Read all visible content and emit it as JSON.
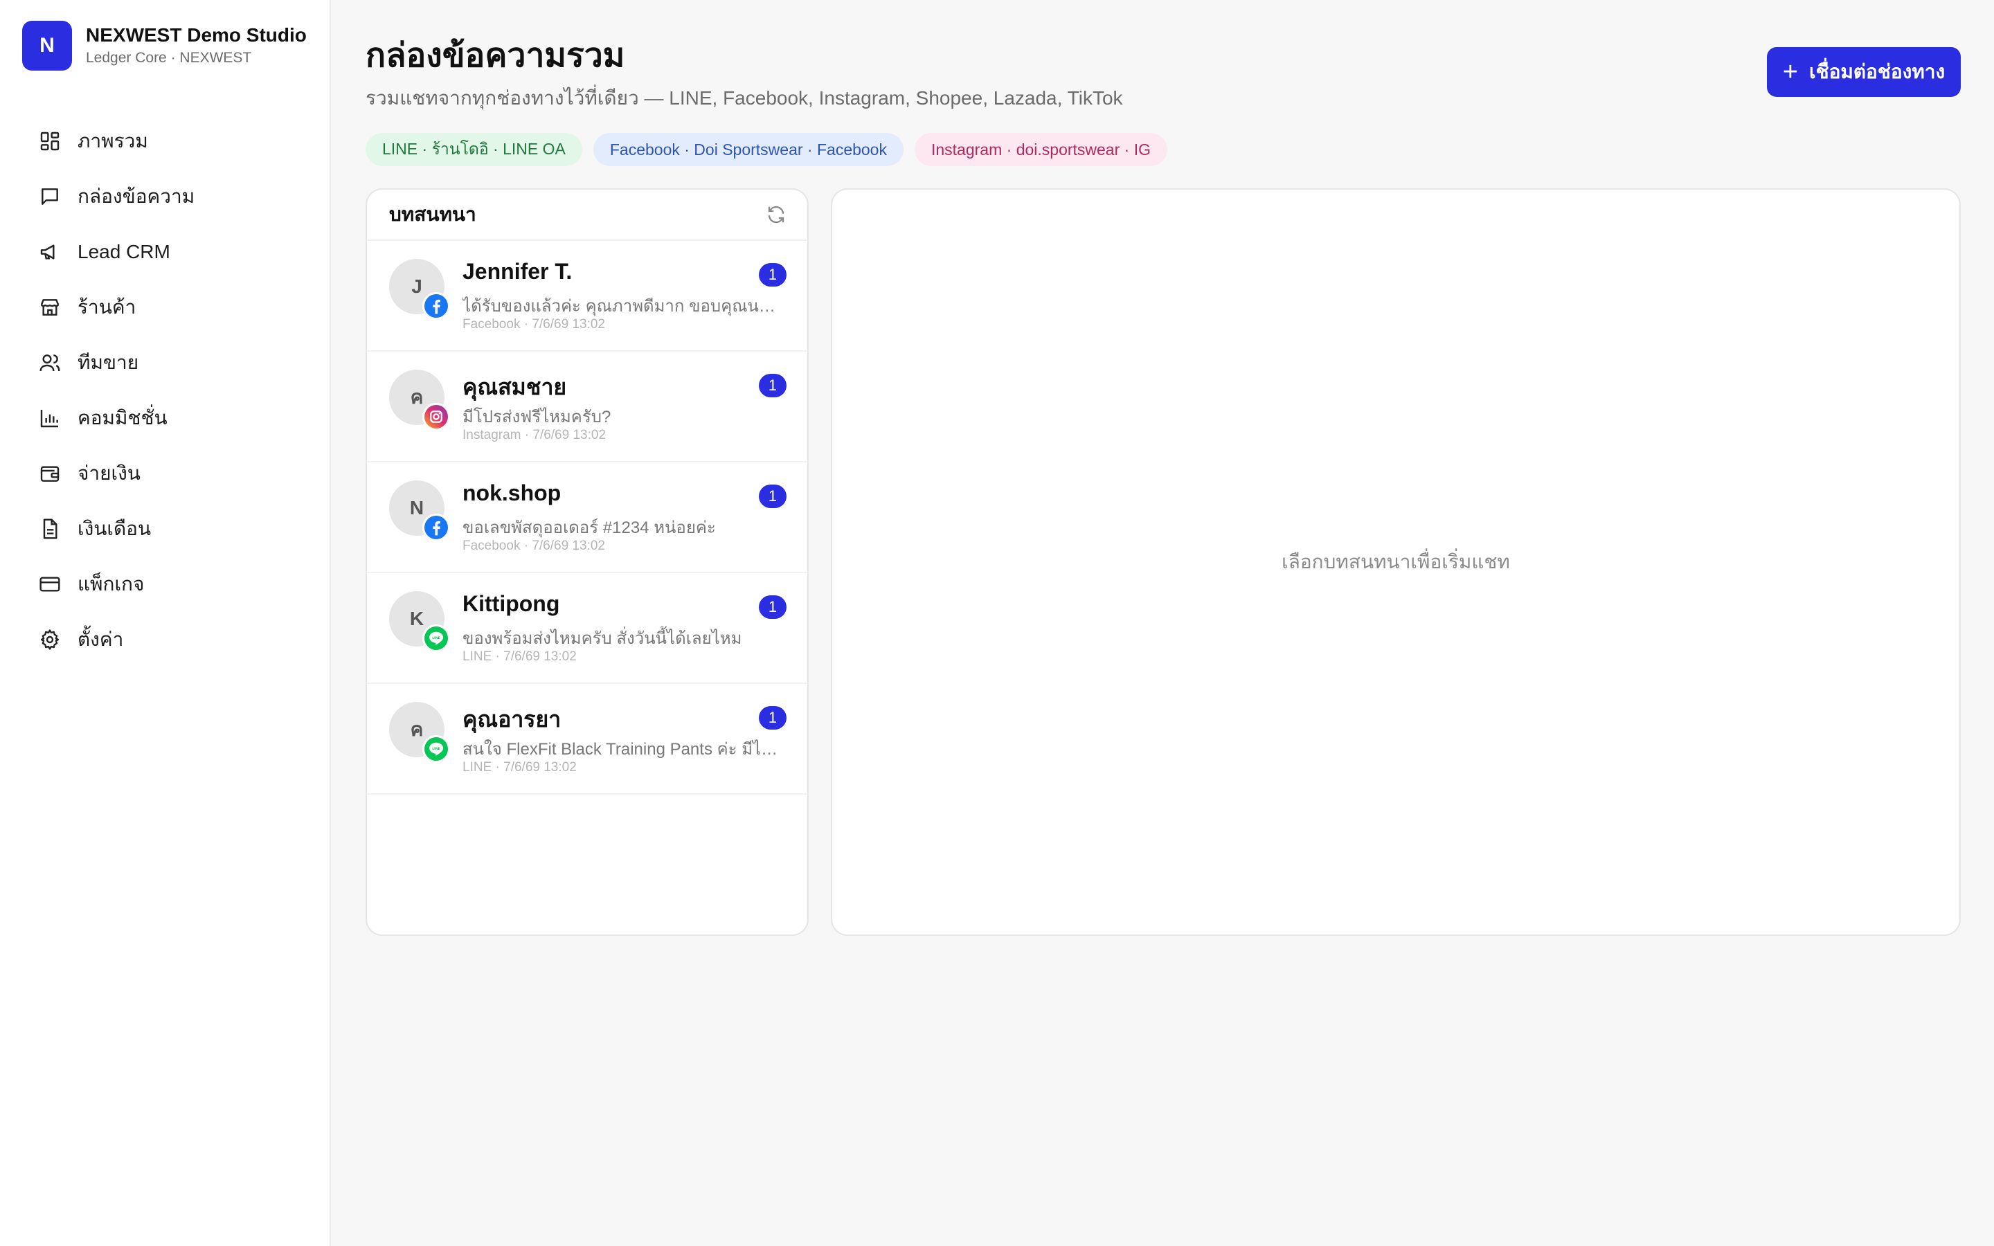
{
  "brand": {
    "logo_letter": "N",
    "name": "NEXWEST Demo Studio",
    "subtitle": "Ledger Core · NEXWEST",
    "accent": "#2a2ee0"
  },
  "nav": {
    "items": [
      {
        "label": "ภาพรวม",
        "icon": "dashboard-icon"
      },
      {
        "label": "กล่องข้อความ",
        "icon": "chat-icon"
      },
      {
        "label": "Lead CRM",
        "icon": "megaphone-icon"
      },
      {
        "label": "ร้านค้า",
        "icon": "store-icon"
      },
      {
        "label": "ทีมขาย",
        "icon": "users-icon"
      },
      {
        "label": "คอมมิชชั่น",
        "icon": "bar-chart-icon"
      },
      {
        "label": "จ่ายเงิน",
        "icon": "wallet-icon"
      },
      {
        "label": "เงินเดือน",
        "icon": "document-icon"
      },
      {
        "label": "แพ็กเกจ",
        "icon": "credit-card-icon"
      },
      {
        "label": "ตั้งค่า",
        "icon": "gear-icon"
      }
    ]
  },
  "header": {
    "title": "กล่องข้อความรวม",
    "subtitle": "รวมแชทจากทุกช่องทางไว้ที่เดียว — LINE, Facebook, Instagram, Shopee, Lazada, TikTok",
    "connect_button": "เชื่อมต่อช่องทาง"
  },
  "channels": [
    {
      "label": "LINE · ร้านโดอิ · LINE OA",
      "type": "line"
    },
    {
      "label": "Facebook · Doi Sportswear · Facebook",
      "type": "facebook"
    },
    {
      "label": "Instagram · doi.sportswear · IG",
      "type": "instagram"
    }
  ],
  "conversations": {
    "title": "บทสนทนา",
    "items": [
      {
        "initial": "J",
        "name": "Jennifer T.",
        "preview": "ได้รับของแล้วค่ะ คุณภาพดีมาก ขอบคุณนะคะ 😊",
        "meta": "Facebook · 7/6/69 13:02",
        "unread": "1",
        "channel": "facebook"
      },
      {
        "initial": "ค",
        "name": "คุณสมชาย",
        "preview": "มีโปรส่งฟรีไหมครับ?",
        "meta": "Instagram · 7/6/69 13:02",
        "unread": "1",
        "channel": "instagram"
      },
      {
        "initial": "N",
        "name": "nok.shop",
        "preview": "ขอเลขพัสดุออเดอร์ #1234 หน่อยค่ะ",
        "meta": "Facebook · 7/6/69 13:02",
        "unread": "1",
        "channel": "facebook"
      },
      {
        "initial": "K",
        "name": "Kittipong",
        "preview": "ของพร้อมส่งไหมครับ สั่งวันนี้ได้เลยไหม",
        "meta": "LINE · 7/6/69 13:02",
        "unread": "1",
        "channel": "line"
      },
      {
        "initial": "ค",
        "name": "คุณอารยา",
        "preview": "สนใจ FlexFit Black Training Pants ค่ะ มีไซซ์ M ไหมคะ",
        "meta": "LINE · 7/6/69 13:02",
        "unread": "1",
        "channel": "line"
      }
    ]
  },
  "chat": {
    "empty_text": "เลือกบทสนทนาเพื่อเริ่มแชท"
  },
  "colors": {
    "line": "#06c755",
    "facebook": "#1877f2",
    "instagram": "#e1306c"
  }
}
